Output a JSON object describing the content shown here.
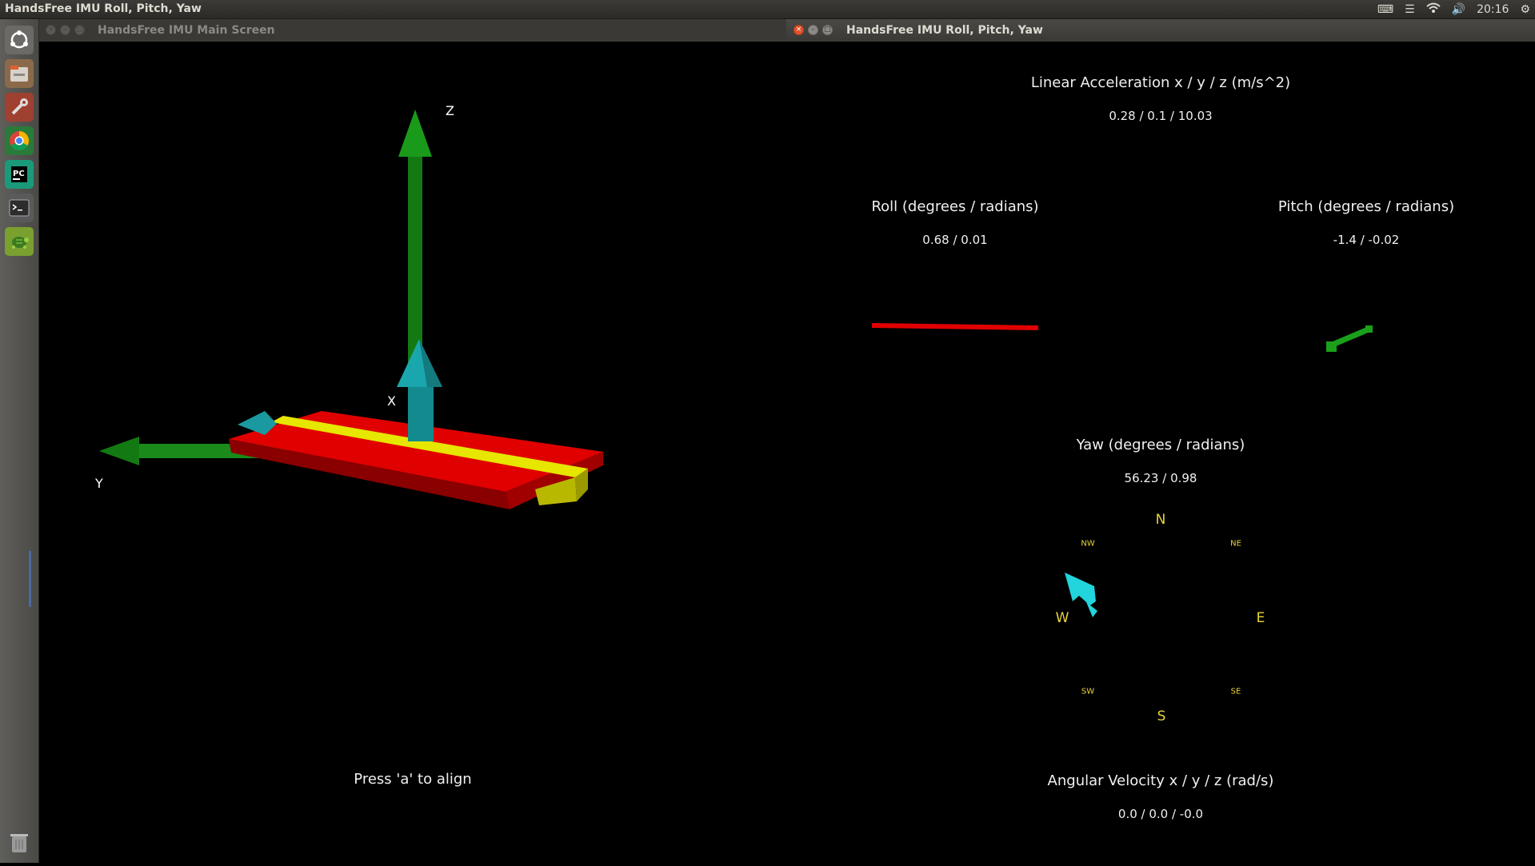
{
  "top_bar": {
    "title": "HandsFree IMU Roll, Pitch, Yaw",
    "time": "20:16"
  },
  "launcher": {
    "items": [
      {
        "icon": "ubuntu-dash-icon"
      },
      {
        "icon": "file-manager-icon"
      },
      {
        "icon": "system-settings-icon"
      },
      {
        "icon": "chrome-browser-icon"
      },
      {
        "icon": "pycharm-icon"
      },
      {
        "icon": "terminal-icon"
      },
      {
        "icon": "ros-turtle-icon"
      },
      {
        "icon": "trash-icon"
      }
    ]
  },
  "left_window": {
    "title": "HandsFree IMU Main Screen",
    "axis_labels": {
      "z": "Z",
      "x": "X",
      "y": "Y"
    },
    "hint": "Press 'a' to align"
  },
  "right_window": {
    "title": "HandsFree IMU Roll, Pitch, Yaw",
    "linear_acceleration": {
      "heading": "Linear Acceleration x / y / z (m/s^2)",
      "value": "0.28 / 0.1 / 10.03"
    },
    "roll": {
      "heading": "Roll (degrees / radians)",
      "value": "0.68 / 0.01"
    },
    "pitch": {
      "heading": "Pitch (degrees / radians)",
      "value": "-1.4 / -0.02"
    },
    "yaw": {
      "heading": "Yaw (degrees / radians)",
      "value": "56.23 / 0.98"
    },
    "compass": {
      "n": "N",
      "ne": "NE",
      "e": "E",
      "se": "SE",
      "s": "S",
      "sw": "SW",
      "w": "W",
      "nw": "NW"
    },
    "angular_velocity": {
      "heading": "Angular Velocity x / y / z (rad/s)",
      "value": "0.0 / 0.0 / -0.0"
    }
  },
  "colors": {
    "board_red": "#e00000",
    "board_yellow": "#e6e600",
    "axis_green": "#1a8a1a",
    "axis_cyan": "#1a9aa0",
    "compass_arrow": "#22d4dc",
    "compass_text": "#e8d43a"
  }
}
